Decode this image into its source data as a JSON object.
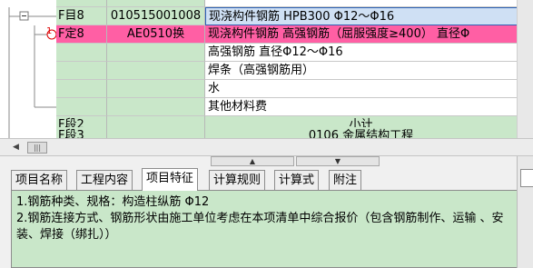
{
  "grid": {
    "rows": [
      {
        "code": "F目8",
        "num": "010515001008",
        "name": "现浇构件钢筋  HPB300   Φ12～Φ16"
      },
      {
        "code": "F定8",
        "num": "AE0510换",
        "name": "现浇构件钢筋 高强钢筋（屈服强度≥400） 直径Φ"
      },
      {
        "code": "",
        "num": "",
        "name": "高强钢筋 直径Φ12～Φ16"
      },
      {
        "code": "",
        "num": "",
        "name": "焊条（高强钢筋用）"
      },
      {
        "code": "",
        "num": "",
        "name": "水"
      },
      {
        "code": "",
        "num": "",
        "name": "其他材料费"
      },
      {
        "code": "F段2",
        "num": "",
        "name": "小计"
      },
      {
        "code": "F段3",
        "num": "",
        "name": "0106  金属结构工程"
      }
    ],
    "marker_1": "1"
  },
  "tabs": [
    "项目名称",
    "工程内容",
    "项目特征",
    "计算规则",
    "计算式",
    "附注"
  ],
  "active_tab": "项目特征",
  "panel": {
    "line1": "1.钢筋种类、规格：构造柱纵筋 Φ12",
    "line2": "2.钢筋连接方式、钢筋形状由施工单位考虑在本项清单中综合报价（包含钢筋制作、运输 、安装、焊接（绑扎））"
  },
  "colors": {
    "green": "#c9e7c9",
    "pink": "#ff5fa4",
    "selected": "#cfe0f4"
  }
}
